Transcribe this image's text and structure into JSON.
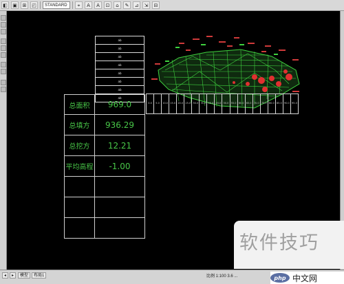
{
  "toolbar": {
    "buttons_left": [
      "◧",
      "▣",
      "⊞",
      "◰"
    ],
    "style_combo": "STANDARD",
    "buttons_right": [
      "⌖",
      "A",
      "A",
      "⊡",
      "⌂",
      "✎",
      "⊿",
      "⇲",
      "⊟"
    ]
  },
  "summary_table": {
    "rows": [
      {
        "label": "总面积",
        "value": "969.0"
      },
      {
        "label": "总填方",
        "value": "936.29"
      },
      {
        "label": "总挖方",
        "value": "12.21"
      },
      {
        "label": "平均高程",
        "value": "-1.00"
      },
      {
        "label": "",
        "value": ""
      },
      {
        "label": "",
        "value": ""
      },
      {
        "label": "",
        "value": ""
      }
    ]
  },
  "top_grid": {
    "cells": [
      "ab",
      "ab",
      "ab",
      "ab",
      "ab",
      "ab",
      "ab",
      "ab"
    ]
  },
  "station_row": {
    "cells": [
      "0.0",
      "5.0",
      "10.0",
      "15.0",
      "20.0",
      "25.0",
      "30.0",
      "35.0",
      "40.0",
      "45.0",
      "50.0",
      "55.0",
      "60.0",
      "65.0",
      "70.0",
      "75.0",
      "80.0",
      "85.0",
      "90.0",
      "95.0"
    ]
  },
  "status_bar": {
    "tabs": [
      "◂",
      "▸",
      "模型",
      "布局1"
    ],
    "coords": "比例 1:100  3.6 ..."
  },
  "watermark": {
    "text": "软件技巧",
    "site": "中文网",
    "logo": "php"
  },
  "colors": {
    "background": "#000000",
    "table_text": "#48c648",
    "terrain_green": "#3fd23f",
    "terrain_red": "#e03030"
  }
}
